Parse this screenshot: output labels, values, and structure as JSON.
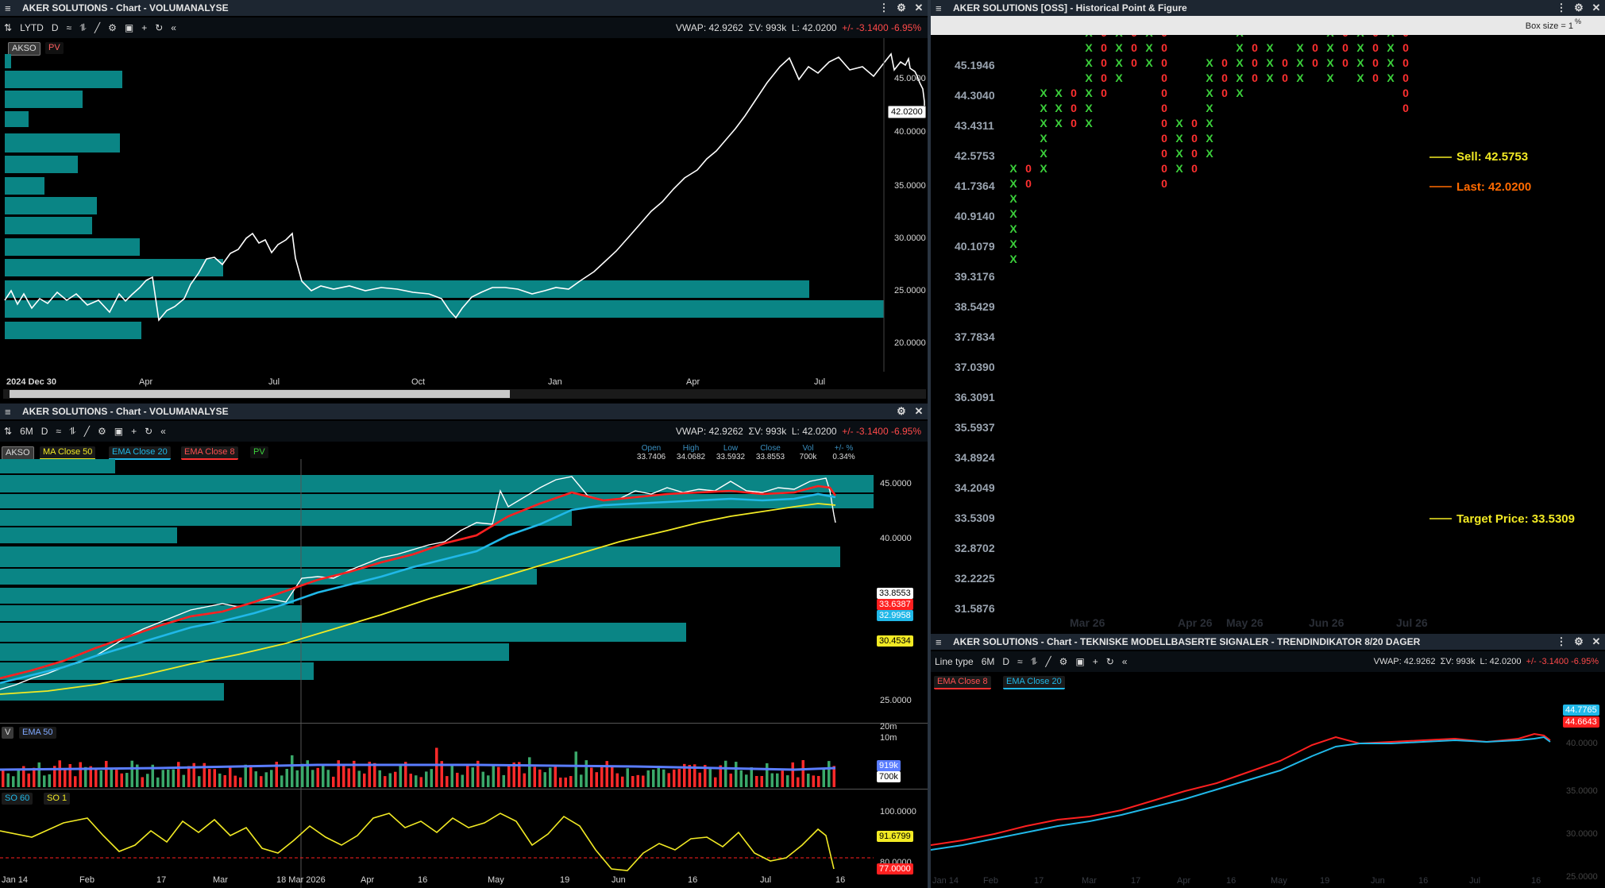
{
  "colors": {
    "bg": "#000000",
    "titlebar": "#1d2631",
    "teal": "#0a8585",
    "red": "#ff3030",
    "green": "#3cd13c",
    "cyan": "#20b8e8",
    "yellow": "#f2ea24",
    "orange": "#ff6a00"
  },
  "p1": {
    "title": "AKER SOLUTIONS - Chart - VOLUMANALYSE",
    "toolbar": {
      "period": "LYTD",
      "interval": "D",
      "vwap": "VWAP: 42.9262",
      "sv": "ΣV: 993k",
      "last": "L: 42.0200",
      "chg": "+/- -3.1400 -6.95%"
    },
    "tags": [
      "AKSO",
      "PV"
    ],
    "yticks": [
      "45.0000",
      "40.0000",
      "35.0000",
      "30.0000",
      "25.0000",
      "20.0000"
    ],
    "price_box": "42.0200",
    "xticks": [
      "2024 Dec 30",
      "Apr",
      "Jul",
      "Oct",
      "Jan",
      "Apr",
      "Jul"
    ]
  },
  "p2": {
    "title": "AKER SOLUTIONS - Chart - VOLUMANALYSE",
    "toolbar": {
      "period": "6M",
      "interval": "D",
      "vwap": "VWAP: 42.9262",
      "sv": "ΣV: 993k",
      "last": "L: 42.0200",
      "chg": "+/- -3.1400 -6.95%"
    },
    "tags": [
      "AKSO",
      "MA Close 50",
      "EMA Close 20",
      "EMA Close 8",
      "PV"
    ],
    "ohlc_head": [
      "Open",
      "High",
      "Low",
      "Close",
      "Vol",
      "+/- %"
    ],
    "ohlc_vals": [
      "33.7406",
      "34.0682",
      "33.5932",
      "33.8553",
      "700k",
      "0.34%"
    ],
    "yticks": [
      "45.0000",
      "40.0000",
      "25.0000"
    ],
    "boxes": [
      "33.8553",
      "33.6387",
      "32.9958",
      "30.4534"
    ],
    "vol": {
      "tags": [
        "V",
        "EMA 50"
      ],
      "ticks": [
        "20m",
        "10m"
      ],
      "boxes": [
        "919k",
        "700k"
      ]
    },
    "so": {
      "tags": [
        "SO 60",
        "SO 1"
      ],
      "ticks": [
        "100.0000",
        "80.0000"
      ],
      "boxes": [
        "91.6799",
        "77.0000"
      ]
    },
    "xticks": [
      "Jan 14",
      "Feb",
      "17",
      "Mar",
      "18 Mar 2026",
      "Apr",
      "16",
      "May",
      "19",
      "Jun",
      "16",
      "Jul",
      "16"
    ]
  },
  "p3": {
    "title": "AKER SOLUTIONS [OSS] - Historical Point & Figure",
    "boxsize": "Box size = 1",
    "boxsize_sup": "%",
    "prices": [
      "45.1946",
      "44.3040",
      "43.4311",
      "42.5753",
      "41.7364",
      "40.9140",
      "40.1079",
      "39.3176",
      "38.5429",
      "37.7834",
      "37.0390",
      "36.3091",
      "35.5937",
      "34.8924",
      "34.2049",
      "33.5309",
      "32.8702",
      "32.2225",
      "31.5876"
    ],
    "sell": "Sell: 42.5753",
    "last": "Last: 42.0200",
    "target": "Target Price: 33.5309",
    "xticks": [
      "Mar 26",
      "Apr 26",
      "May 26",
      "Jun 26",
      "Jul 26"
    ]
  },
  "p4": {
    "title": "AKER SOLUTIONS - Chart - TEKNISKE MODELLBASERTE SIGNALER - TRENDINDIKATOR 8/20 DAGER",
    "toolbar": {
      "linetype": "Line type",
      "period": "6M",
      "interval": "D",
      "vwap": "VWAP: 42.9262",
      "sv": "ΣV: 993k",
      "last": "L: 42.0200",
      "chg": "+/- -3.1400 -6.95%"
    },
    "tags": [
      "EMA Close 8",
      "EMA Close 20"
    ],
    "yticks": [
      "40.0000",
      "35.0000",
      "30.0000",
      "25.0000"
    ],
    "boxes": [
      "44.7765",
      "44.6643"
    ],
    "xticks": [
      "Jan 14",
      "Feb",
      "17",
      "Mar",
      "17",
      "Apr",
      "16",
      "May",
      "19",
      "Jun",
      "16",
      "Jul",
      "16"
    ]
  }
}
